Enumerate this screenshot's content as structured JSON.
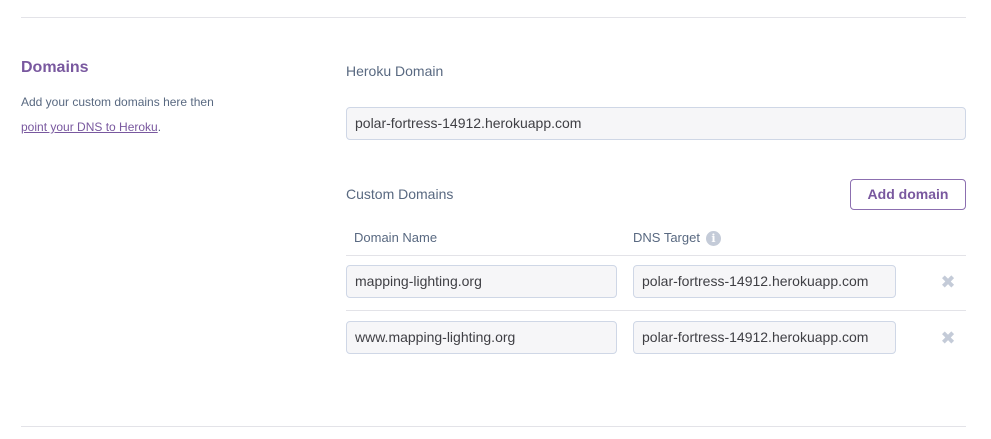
{
  "section": {
    "title": "Domains",
    "description_prefix": "Add your custom domains here then",
    "description_link": "point your DNS to Heroku",
    "description_suffix": "."
  },
  "heroku_domain": {
    "label": "Heroku Domain",
    "value": "polar-fortress-14912.herokuapp.com"
  },
  "custom_domains": {
    "label": "Custom Domains",
    "add_button_label": "Add domain",
    "columns": {
      "domain_name": "Domain Name",
      "dns_target": "DNS Target"
    },
    "info_icon": "info-icon",
    "remove_icon": "close-icon",
    "rows": [
      {
        "domain_name": "mapping-lighting.org",
        "dns_target": "polar-fortress-14912.herokuapp.com"
      },
      {
        "domain_name": "www.mapping-lighting.org",
        "dns_target": "polar-fortress-14912.herokuapp.com"
      }
    ]
  },
  "colors": {
    "accent": "#79589f",
    "muted_text": "#596981",
    "field_bg": "#f6f6f8",
    "border": "#cfd7e6"
  }
}
